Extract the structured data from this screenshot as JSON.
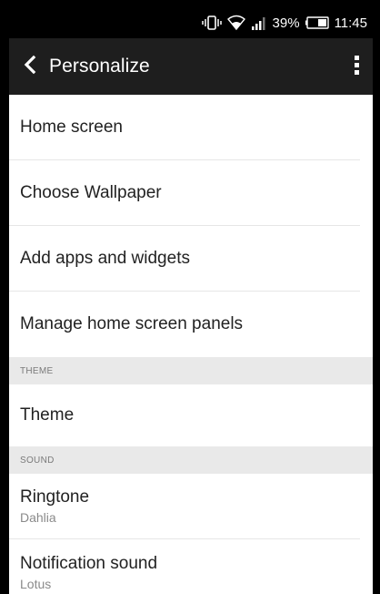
{
  "status_bar": {
    "battery": "39%",
    "time": "11:45",
    "icons": [
      "vibrate-icon",
      "wifi-icon",
      "signal-icon",
      "battery-icon"
    ]
  },
  "action_bar": {
    "title": "Personalize",
    "back_icon": "chevron-left-icon",
    "overflow_icon": "overflow-menu-icon"
  },
  "items_general": [
    {
      "label": "Home screen"
    },
    {
      "label": "Choose Wallpaper"
    },
    {
      "label": "Add apps and widgets"
    },
    {
      "label": "Manage home screen panels"
    }
  ],
  "sections": {
    "theme": {
      "header": "THEME",
      "items": [
        {
          "label": "Theme"
        }
      ]
    },
    "sound": {
      "header": "SOUND",
      "items": [
        {
          "label": "Ringtone",
          "value": "Dahlia"
        },
        {
          "label": "Notification sound",
          "value": "Lotus"
        }
      ]
    }
  },
  "colors": {
    "action_bar": "#1e1e1e",
    "status_bar": "#000000",
    "section_header": "#e9e9e9"
  }
}
